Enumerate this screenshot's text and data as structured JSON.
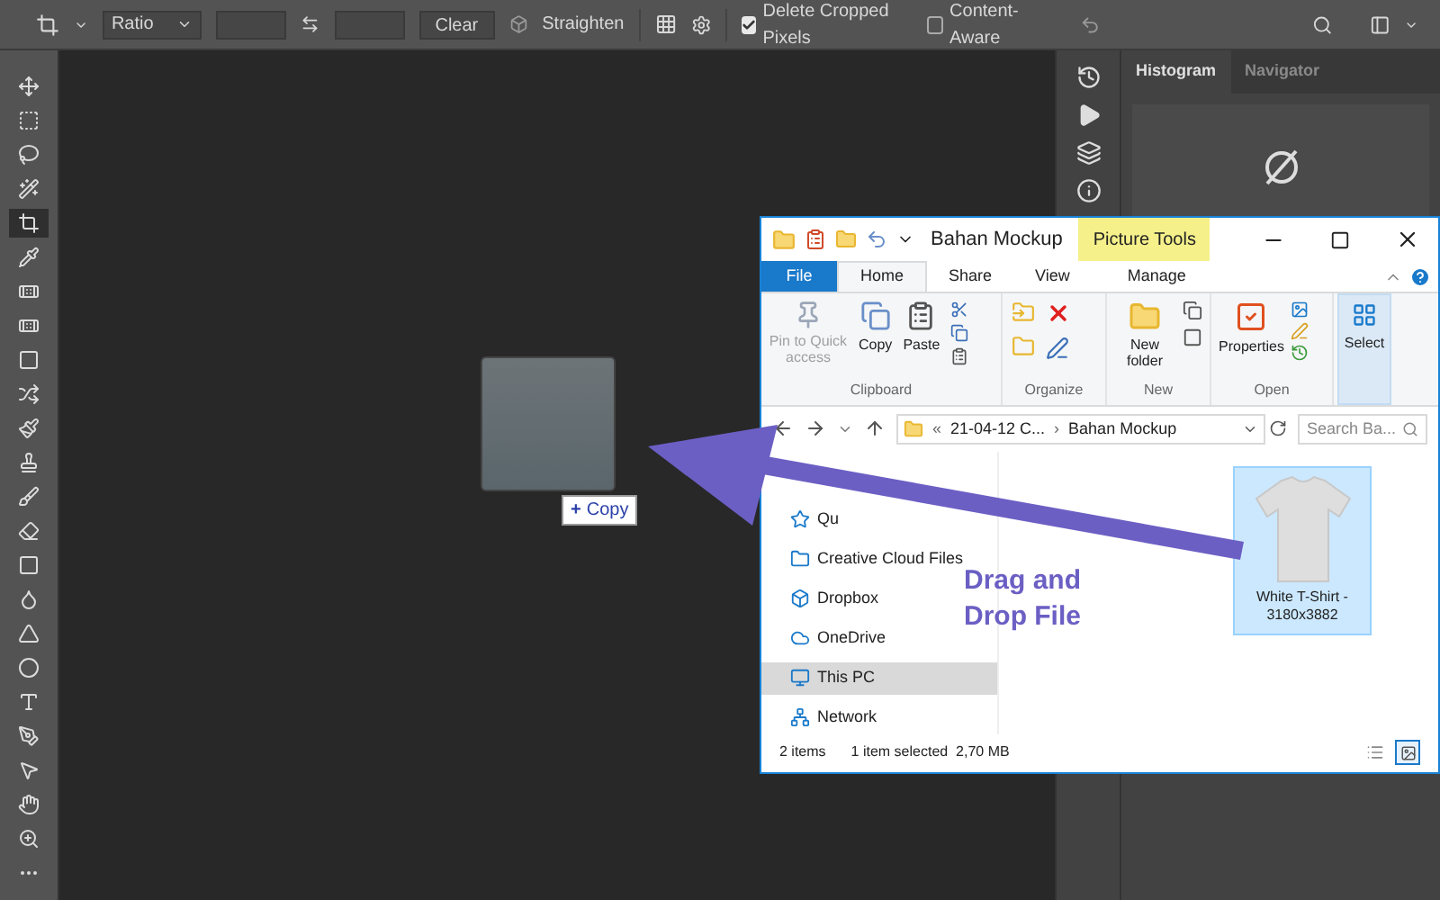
{
  "options_bar": {
    "ratio_select": "Ratio",
    "clear_button": "Clear",
    "straighten_label": "Straighten",
    "checkboxes": [
      {
        "label": "Delete Cropped Pixels",
        "checked": true
      },
      {
        "label": "Content-Aware",
        "checked": false
      }
    ]
  },
  "tools": [
    {
      "selected": false
    },
    {
      "selected": false
    },
    {
      "selected": false
    },
    {
      "selected": false
    },
    {
      "selected": true
    },
    {
      "selected": false
    },
    {
      "selected": false
    },
    {
      "selected": false
    },
    {
      "selected": false
    },
    {
      "selected": false
    },
    {
      "selected": false
    },
    {
      "selected": false
    },
    {
      "selected": false
    },
    {
      "selected": false
    },
    {
      "selected": false
    },
    {
      "selected": false
    },
    {
      "selected": false
    },
    {
      "selected": false
    },
    {
      "selected": false
    },
    {
      "selected": false
    },
    {
      "selected": false
    },
    {
      "selected": false
    },
    {
      "selected": false
    },
    {
      "selected": false
    }
  ],
  "drag_badge": {
    "icon": "+",
    "label": "Copy"
  },
  "panel": {
    "tabs": [
      {
        "label": "Histogram",
        "selected": true
      },
      {
        "label": "Navigator",
        "selected": false
      }
    ]
  },
  "explorer": {
    "title": "Bahan Mockup",
    "context_tab": "Picture Tools",
    "tabs": [
      {
        "label": "File",
        "kind": "file",
        "selected": false
      },
      {
        "label": "Home",
        "kind": "tab",
        "selected": true
      },
      {
        "label": "Share",
        "kind": "tab",
        "selected": false
      },
      {
        "label": "View",
        "kind": "tab",
        "selected": false
      },
      {
        "label": "Manage",
        "kind": "tab",
        "selected": false
      }
    ],
    "ribbon": {
      "pin": {
        "label": "Pin to Quick access",
        "disabled": true
      },
      "copy": "Copy",
      "paste": "Paste",
      "clipboard": "Clipboard",
      "organize": "Organize",
      "new_folder": "New folder",
      "new": "New",
      "properties": "Properties",
      "open": "Open",
      "select": "Select"
    },
    "address": {
      "prefix": "«",
      "crumbs": [
        "21-04-12 C...",
        "Bahan Mockup"
      ],
      "separator": "›",
      "search_placeholder": "Search Ba..."
    },
    "nav": [
      {
        "label": "Qu",
        "selected": false
      },
      {
        "label": "Creative Cloud Files",
        "selected": false
      },
      {
        "label": "Dropbox",
        "selected": false
      },
      {
        "label": "OneDrive",
        "selected": false
      },
      {
        "label": "This PC",
        "selected": true
      },
      {
        "label": "Network",
        "selected": false
      }
    ],
    "files": [
      {
        "name": "White T-Shirt - 3180x3882",
        "selected": true
      }
    ],
    "status": {
      "count": "2 items",
      "selection": "1 item selected  2,70 MB"
    },
    "views": [
      {
        "selected": false
      },
      {
        "selected": true
      }
    ]
  },
  "overlay_text": "Drag and Drop File"
}
